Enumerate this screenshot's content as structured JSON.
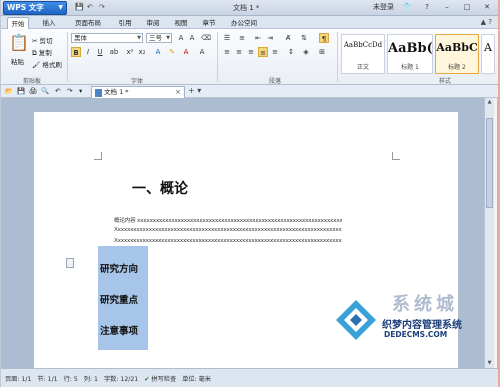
{
  "app": {
    "menu_button": "WPS 文字",
    "doc_title": "文档 1 *",
    "login": "未登录"
  },
  "menu_tabs": [
    "开始",
    "插入",
    "页面布局",
    "引用",
    "审阅",
    "视图",
    "章节",
    "办公空间"
  ],
  "ribbon": {
    "clipboard": {
      "paste": "粘贴",
      "cut": "剪切",
      "copy": "复制",
      "format_painter": "格式刷",
      "label": "剪贴板"
    },
    "font": {
      "name": "黑体",
      "size": "三号",
      "label": "字体"
    },
    "paragraph": {
      "label": "段落"
    },
    "styles": {
      "items": [
        {
          "sample": "AaBbCcDd",
          "name": "正文"
        },
        {
          "sample": "AaBb(",
          "name": "标题 1"
        },
        {
          "sample": "AaBbC",
          "name": "标题 2"
        },
        {
          "sample": "A",
          "name": ""
        }
      ],
      "label": "样式"
    }
  },
  "doc_tab": {
    "name": "文档 1 *"
  },
  "document": {
    "heading1": "一、概论",
    "body_lines": [
      "概论内容 xxxxxxxxxxxxxxxxxxxxxxxxxxxxxxxxxxxxxxxxxxxxxxxxxxxxxxxxxxxxxxxxxxxxxxxxxxxxx",
      "Xxxxxxxxxxxxxxxxxxxxxxxxxxxxxxxxxxxxxxxxxxxxxxxxxxxxxxxxxxxxxxxxxxxxxxxxxxxxxxxxxx",
      "Xxxxxxxxxxxxxxxxxxxxxxxxxxxxxxxxxxxxxxxxxxxxxxxxxxxxxxxxxxxxxxxxxxxxxxxxxxxxxxxxxx"
    ],
    "headings2": [
      "研究方向",
      "研究重点",
      "注意事项"
    ]
  },
  "watermark": {
    "big": "系统城",
    "title": "织梦内容管理系统",
    "url": "DEDECMS.COM"
  },
  "status": {
    "page": "页面: 1/1",
    "section": "节: 1/1",
    "row": "行: 5",
    "col": "列: 1",
    "words": "字数: 12/21",
    "spell": "拼写检查",
    "unit": "单位: 毫米"
  },
  "colors": {
    "accent": "#1f64c4",
    "selection": "#a7c5e8",
    "doc_bg": "#acbdd1"
  }
}
